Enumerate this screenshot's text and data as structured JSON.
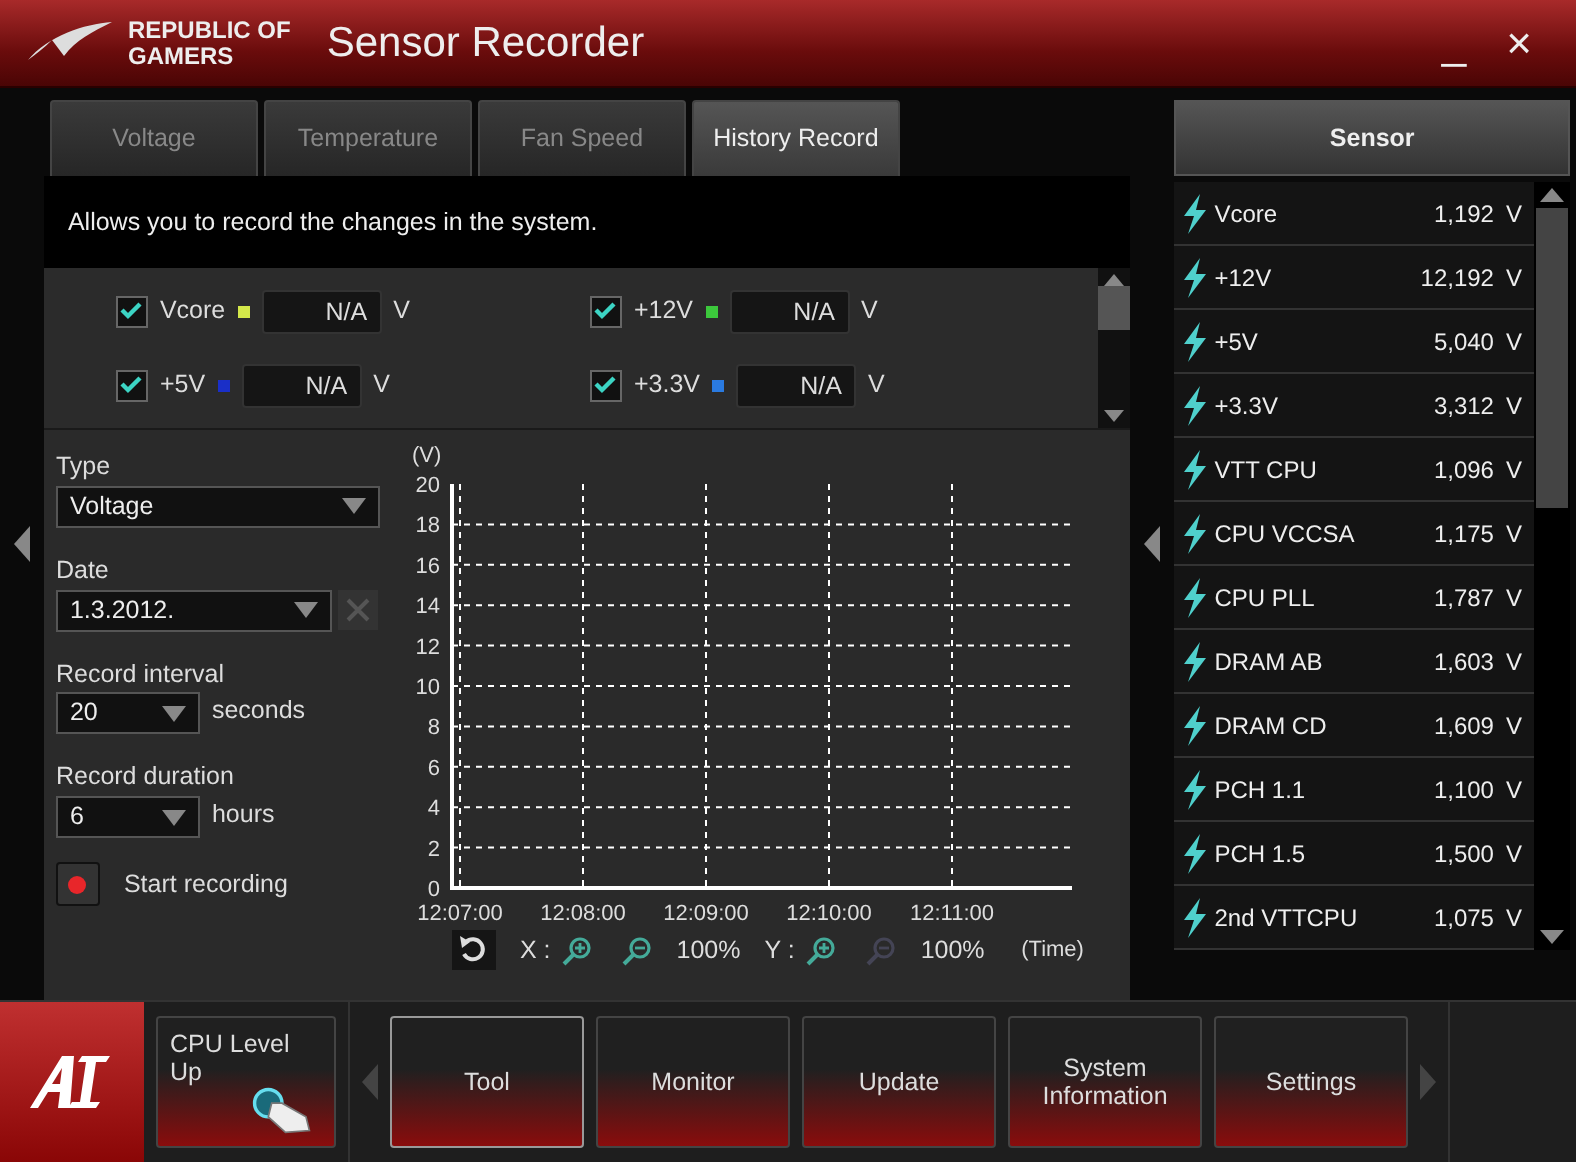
{
  "window": {
    "brand": [
      "REPUBLIC OF",
      "GAMERS"
    ],
    "title": "Sensor Recorder",
    "buttons": [
      "_",
      "×"
    ]
  },
  "tabs": [
    {
      "label": "Voltage",
      "selected": false
    },
    {
      "label": "Temperature",
      "selected": false
    },
    {
      "label": "Fan Speed",
      "selected": false
    },
    {
      "label": "History Record",
      "selected": true
    }
  ],
  "description": "Allows you to record the changes in the system.",
  "channels": [
    {
      "name": "Vcore",
      "checked": true,
      "color": "#d4e84a",
      "value": "N/A",
      "unit": "V"
    },
    {
      "name": "+12V",
      "checked": true,
      "color": "#3cc83c",
      "value": "N/A",
      "unit": "V"
    },
    {
      "name": "+5V",
      "checked": true,
      "color": "#1a2fc8",
      "value": "N/A",
      "unit": "V"
    },
    {
      "name": "+3.3V",
      "checked": true,
      "color": "#2a7ae0",
      "value": "N/A",
      "unit": "V"
    }
  ],
  "settings": {
    "type": {
      "label": "Type",
      "value": "Voltage"
    },
    "date": {
      "label": "Date",
      "value": "1.3.2012."
    },
    "record_interval": {
      "label": "Record interval",
      "value": "20",
      "unit": "seconds"
    },
    "record_duration": {
      "label": "Record duration",
      "value": "6",
      "unit": "hours"
    },
    "start_recording": "Start recording"
  },
  "chart": {
    "chart_data": {
      "type": "line",
      "xlabel": "(Time)",
      "ylabel": "(V)",
      "ylim": [
        0,
        20
      ],
      "grid": true,
      "categories": [
        "12:07:00",
        "12:08:00",
        "12:09:00",
        "12:10:00",
        "12:11:00"
      ],
      "yticks": [
        0,
        2,
        4,
        6,
        8,
        10,
        12,
        14,
        16,
        18,
        20
      ]
    },
    "zoom": [
      {
        "axis_label": "X :",
        "zoom_out_disabled": false,
        "percent": "100%"
      },
      {
        "axis_label": "Y :",
        "zoom_out_disabled": true,
        "percent": "100%"
      }
    ]
  },
  "sensor_panel": {
    "title": "Sensor",
    "rows": [
      {
        "name": "Vcore",
        "value": "1,192",
        "unit": "V"
      },
      {
        "name": "+12V",
        "value": "12,192",
        "unit": "V"
      },
      {
        "name": "+5V",
        "value": "5,040",
        "unit": "V"
      },
      {
        "name": "+3.3V",
        "value": "3,312",
        "unit": "V"
      },
      {
        "name": "VTT CPU",
        "value": "1,096",
        "unit": "V"
      },
      {
        "name": "CPU VCCSA",
        "value": "1,175",
        "unit": "V"
      },
      {
        "name": "CPU PLL",
        "value": "1,787",
        "unit": "V"
      },
      {
        "name": "DRAM AB",
        "value": "1,603",
        "unit": "V"
      },
      {
        "name": "DRAM CD",
        "value": "1,609",
        "unit": "V"
      },
      {
        "name": "PCH 1.1",
        "value": "1,100",
        "unit": "V"
      },
      {
        "name": "PCH 1.5",
        "value": "1,500",
        "unit": "V"
      },
      {
        "name": "2nd VTTCPU",
        "value": "1,075",
        "unit": "V"
      }
    ]
  },
  "bottom_bar": {
    "cpu_level_up": "CPU Level Up",
    "buttons": [
      {
        "label": "Tool",
        "selected": true
      },
      {
        "label": "Monitor",
        "selected": false
      },
      {
        "label": "Update",
        "selected": false
      },
      {
        "label": "System Information",
        "selected": false
      },
      {
        "label": "Settings",
        "selected": false
      }
    ]
  }
}
